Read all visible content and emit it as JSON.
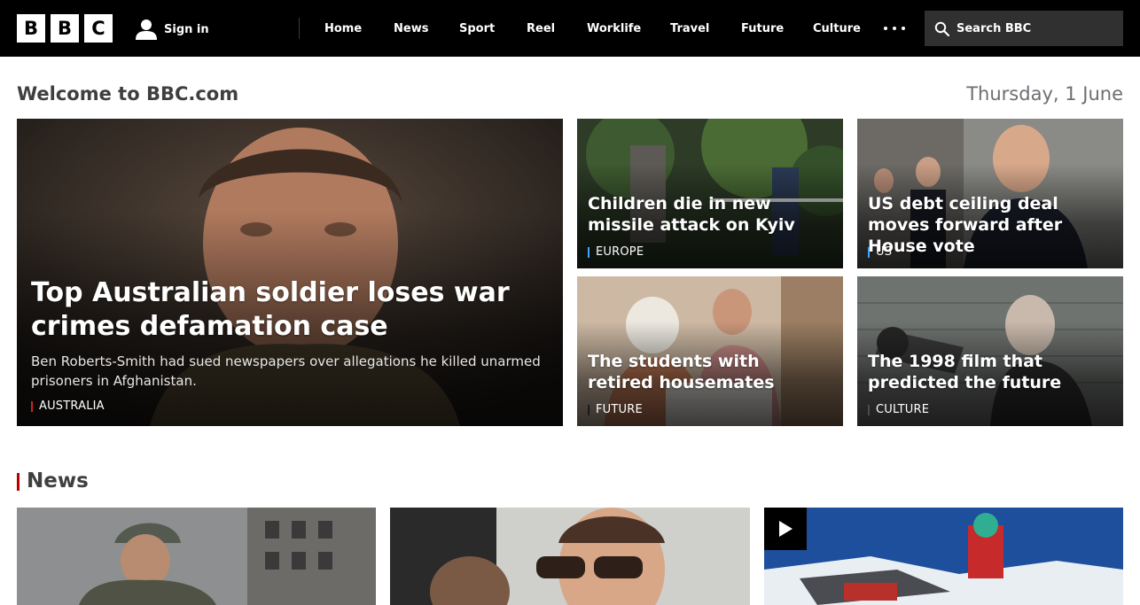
{
  "header": {
    "logo_letters": [
      "B",
      "B",
      "C"
    ],
    "signin_label": "Sign in",
    "nav": [
      "Home",
      "News",
      "Sport",
      "Reel",
      "Worklife",
      "Travel",
      "Future",
      "Culture"
    ],
    "search_placeholder": "Search BBC",
    "icons": {
      "user": "user-icon",
      "more": "more-dots-icon",
      "search": "search-icon"
    }
  },
  "welcome": {
    "title": "Welcome to BBC.com",
    "date": "Thursday, 1 June"
  },
  "promos": [
    {
      "title": "Top Australian soldier loses war crimes defamation case",
      "summary": "Ben Roberts-Smith had sued newspapers over allegations he killed unarmed prisoners in Afghanistan.",
      "tag": "AUSTRALIA",
      "tag_color": "#d41f1f"
    },
    {
      "title": "Children die in new missile attack on Kyiv",
      "tag": "EUROPE",
      "tag_color": "#3ea6ff"
    },
    {
      "title": "US debt ceiling deal moves forward after House vote",
      "tag": "US",
      "tag_color": "#3ea6ff"
    },
    {
      "title": "The students with retired housemates",
      "tag": "FUTURE",
      "tag_color": "#1a1a1a"
    },
    {
      "title": "The 1998 film that predicted the future",
      "tag": "CULTURE",
      "tag_color": "#4a4a4a"
    }
  ],
  "news": {
    "heading": "News",
    "accent_color": "#b80000",
    "play_icon": "play-icon"
  },
  "colors": {
    "topbar": "#000000",
    "search_bg": "#303030",
    "text_muted": "#6e6e73"
  }
}
